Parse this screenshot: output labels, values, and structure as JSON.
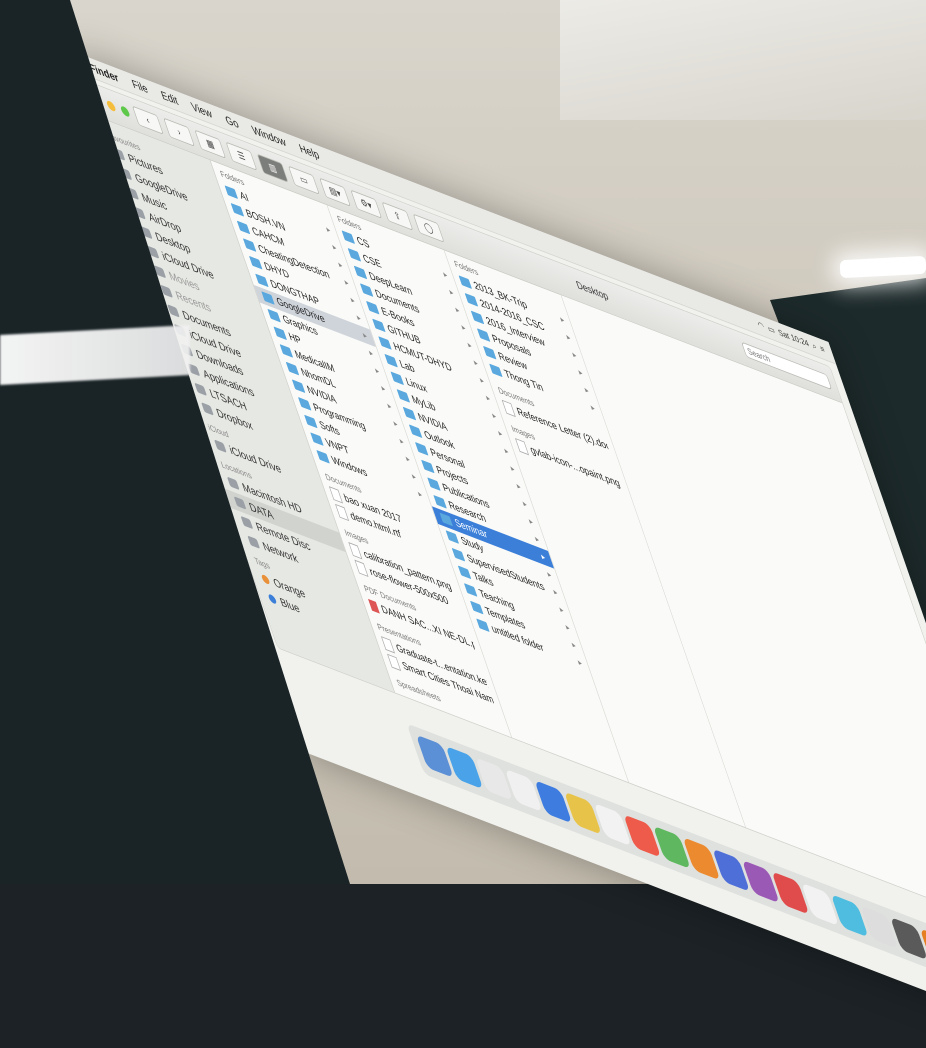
{
  "menubar": {
    "app_name": "Finder",
    "items": [
      "File",
      "Edit",
      "View",
      "Go",
      "Window",
      "Help"
    ],
    "tray_text": "Sat 10:24"
  },
  "window": {
    "title": "Desktop"
  },
  "search": {
    "placeholder": "Search"
  },
  "sidebar": {
    "favourites_header": "Favourites",
    "favourites": [
      "Pictures",
      "GoogleDrive",
      "Music",
      "AirDrop",
      "Desktop",
      "iCloud Drive",
      "Movies",
      "Recents",
      "Documents",
      "iCloud Drive",
      "Downloads",
      "Applications",
      "LTSACH",
      "Dropbox"
    ],
    "icloud_header": "iCloud",
    "icloud": [
      "iCloud Drive"
    ],
    "locations_header": "Locations",
    "locations": [
      "Macintosh HD",
      "DATA",
      "Remote Disc",
      "Network"
    ],
    "tags_header": "Tags",
    "tags": [
      {
        "label": "Orange",
        "color": "#e8913a"
      },
      {
        "label": "Blue",
        "color": "#3b7fd9"
      }
    ]
  },
  "column1": {
    "header": "Folders",
    "folders": [
      "AI",
      "BOSH.VN",
      "CAHCM",
      "CheatingDetection",
      "DHYD",
      "DONGTHAP",
      "GoogleDrive",
      "Graphics",
      "HP",
      "MedicalIM",
      "NhomDL",
      "NVIDIA",
      "Programming",
      "Softs",
      "VNPT",
      "Windows"
    ],
    "documents_header": "Documents",
    "documents": [
      "bao xuan 2017",
      "demo.html.rtf"
    ],
    "images_header": "Images",
    "images": [
      "calibration_pattern.png",
      "rose-flower-500x500"
    ],
    "pdf_header": "PDF Documents",
    "pdfs": [
      "DANH SAC...XI NE-DL.pdf"
    ],
    "presentations_header": "Presentations",
    "presentations": [
      "Graduate-t...entation.key",
      "Smart Cities Thoai Nam"
    ],
    "spreadsheets_header": "Spreadsheets"
  },
  "column2": {
    "header": "Folders",
    "folders": [
      "CS",
      "CSE",
      "DeepLearn",
      "Documents",
      "E-Books",
      "GITHUB",
      "HCMUT-DHYD",
      "Lab",
      "Linux",
      "MyLib",
      "NVIDIA",
      "Outlook",
      "Personal",
      "Projects",
      "Publications",
      "Research",
      "Seminar",
      "Study",
      "SupervisedStudents",
      "Talks",
      "Teaching",
      "Templates",
      "untitled folder"
    ],
    "selected": "Seminar"
  },
  "column3": {
    "header": "Folders",
    "folders": [
      "2013_BK-Trip",
      "2014-2016_CSC",
      "2016_Interview",
      "Proposals",
      "Review",
      "Thong Tin"
    ],
    "documents_header": "Documents",
    "documents": [
      "Reference Letter (2).docx"
    ],
    "images_header": "Images",
    "images": [
      "gvlab-icon-...opaint.png"
    ]
  },
  "dock": {
    "colors": [
      "#5b8fd6",
      "#4aa3e8",
      "#e8e8e8",
      "#f0f0f0",
      "#3e7ce0",
      "#e8c34a",
      "#f2f2f2",
      "#ef5b4a",
      "#5fb85f",
      "#eb8a2f",
      "#4f6fd8",
      "#9b59b6",
      "#e04c4c",
      "#f2f2f2",
      "#4fbde0",
      "#dddddd",
      "#5a5a5a",
      "#e67e22",
      "#3498db",
      "#f5f5f5",
      "#2c3e50",
      "#e74c3c",
      "#27ae60",
      "#f1c40f"
    ]
  }
}
